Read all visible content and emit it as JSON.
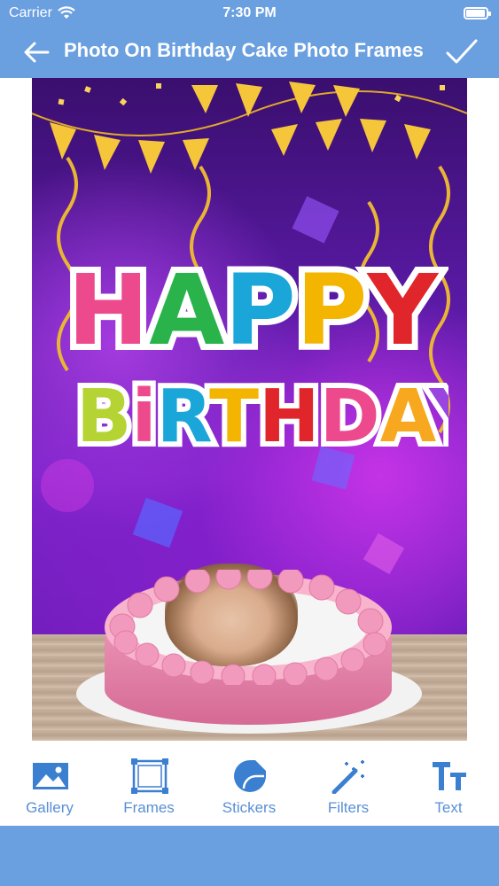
{
  "status": {
    "carrier": "Carrier",
    "time": "7:30 PM"
  },
  "nav": {
    "title": "Photo On Birthday Cake Photo Frames",
    "back_icon": "arrow-left-icon",
    "done_icon": "checkmark-icon"
  },
  "canvas": {
    "headline_1": "HAPPY",
    "headline_2": "BiRTHDAY!"
  },
  "toolbar": {
    "items": [
      {
        "label": "Gallery",
        "icon": "image-icon"
      },
      {
        "label": "Frames",
        "icon": "frame-icon"
      },
      {
        "label": "Stickers",
        "icon": "sticker-icon"
      },
      {
        "label": "Filters",
        "icon": "magic-wand-icon"
      },
      {
        "label": "Text",
        "icon": "text-icon"
      }
    ]
  },
  "colors": {
    "bar": "#6a9fe0",
    "accent": "#3b7fd1"
  }
}
